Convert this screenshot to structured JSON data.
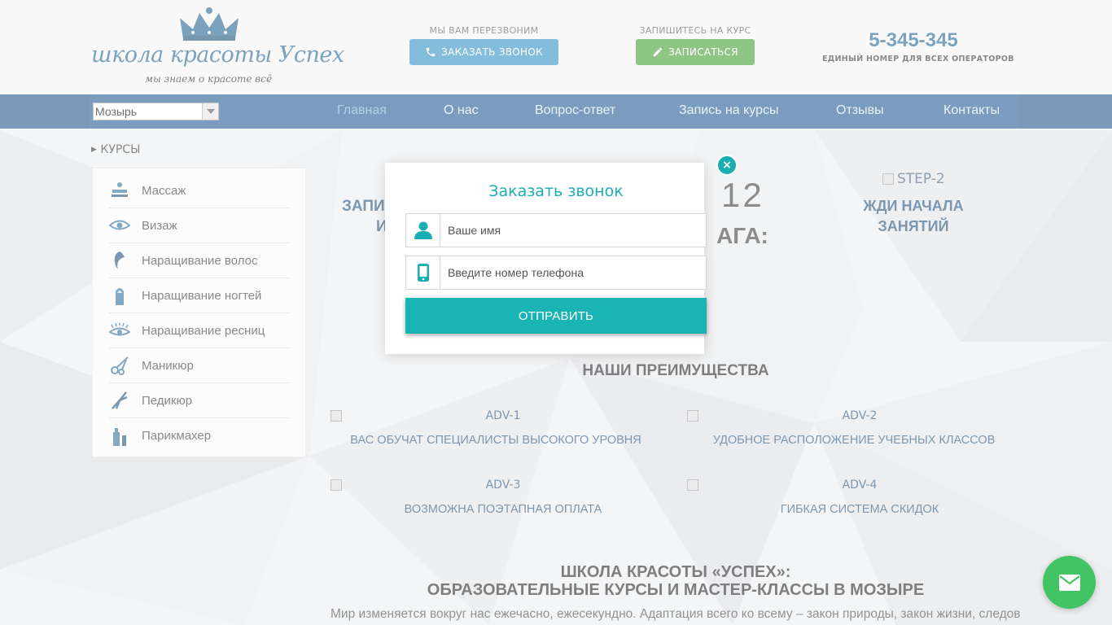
{
  "header": {
    "logo_main": "школа красоты Успех",
    "logo_sub": "мы знаем о красоте всё",
    "callback_label": "МЫ ВАМ ПЕРЕЗВОНИМ",
    "callback_button": "ЗАКАЗАТЬ ЗВОНОК",
    "enroll_label": "ЗАПИШИТЕСЬ НА КУРС",
    "enroll_button": "ЗАПИСАТЬСЯ",
    "phone": "5-345-345",
    "phone_caption": "ЕДИНЫЙ НОМЕР ДЛЯ ВСЕХ ОПЕРАТОРОВ"
  },
  "nav": {
    "city": "Мозырь",
    "items": [
      "Главная",
      "О нас",
      "Вопрос-ответ",
      "Запись на курсы",
      "Отзывы",
      "Контакты"
    ]
  },
  "sidebar": {
    "title": "КУРСЫ",
    "items": [
      {
        "label": "Массаж",
        "icon": "massage-icon"
      },
      {
        "label": "Визаж",
        "icon": "eye-makeup-icon"
      },
      {
        "label": "Наращивание волос",
        "icon": "hair-icon"
      },
      {
        "label": "Наращивание ногтей",
        "icon": "nail-icon"
      },
      {
        "label": "Наращивание ресниц",
        "icon": "eyelash-icon"
      },
      {
        "label": "Маникюр",
        "icon": "scissors-icon"
      },
      {
        "label": "Педикюр",
        "icon": "nippers-icon"
      },
      {
        "label": "Парикмахер",
        "icon": "hairdresser-icon"
      }
    ]
  },
  "main": {
    "step_left_1": "ЗАПИ",
    "step_left_2": "И",
    "step_mid_1": "12",
    "step_mid_2": "АГА:",
    "step2_alt": "STEP-2",
    "step2_line1": "ЖДИ НАЧАЛА",
    "step2_line2": "ЗАНЯТИЙ",
    "adv_title": "НАШИ ПРЕИМУЩЕСТВА",
    "adv": [
      {
        "alt": "ADV-1",
        "text": "ВАС ОБУЧАТ СПЕЦИАЛИСТЫ ВЫСОКОГО УРОВНЯ"
      },
      {
        "alt": "ADV-2",
        "text": "УДОБНОЕ РАСПОЛОЖЕНИЕ УЧЕБНЫХ КЛАССОВ"
      },
      {
        "alt": "ADV-3",
        "text": "ВОЗМОЖНА ПОЭТАПНАЯ ОПЛАТА"
      },
      {
        "alt": "ADV-4",
        "text": "ГИБКАЯ СИСТЕМА СКИДОК"
      }
    ],
    "school_title_1": "ШКОЛА КРАСОТЫ «УСПЕХ»:",
    "school_title_2": "ОБРАЗОВАТЕЛЬНЫЕ КУРСЫ И МАСТЕР-КЛАССЫ В МОЗЫРЕ",
    "paragraph": "Мир изменяется вокруг нас ежечасно, ежесекундно. Адаптация всего ко всему – закон природы, закон жизни, следовать"
  },
  "modal": {
    "title": "Заказать звонок",
    "close": "×",
    "name_placeholder": "Ваше имя",
    "phone_placeholder": "Введите номер телефона",
    "submit": "ОТПРАВИТЬ"
  },
  "colors": {
    "accent": "#1ab4b4",
    "nav": "#1d5590",
    "call_button": "#2b8dc1",
    "enroll_button": "#3f9b2c",
    "fab": "#43c464"
  }
}
